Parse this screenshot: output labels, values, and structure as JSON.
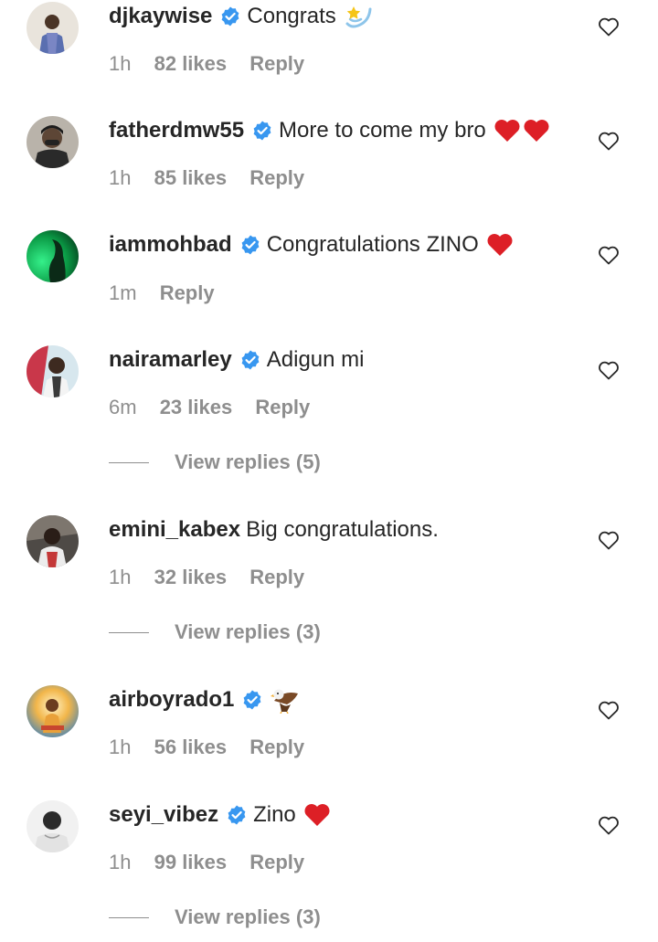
{
  "icons": {
    "verified": "verified-badge-icon",
    "like": "heart-outline-icon",
    "heart_emoji": "red-heart-emoji",
    "sparkles_emoji": "dizzy-star-emoji",
    "eagle_emoji": "eagle-emoji"
  },
  "colors": {
    "verified_blue": "#3897f0",
    "secondary_text": "#8e8e8e",
    "heart_red": "#e0245e"
  },
  "comments": [
    {
      "username": "djkaywise",
      "text": "Congrats",
      "time": "1h",
      "likes": "82 likes",
      "reply": "Reply"
    },
    {
      "username": "fatherdmw55",
      "text": "More to come my bro",
      "time": "1h",
      "likes": "85 likes",
      "reply": "Reply"
    },
    {
      "username": "iammohbad",
      "text": "Congratulations ZINO",
      "time": "1m",
      "reply": "Reply"
    },
    {
      "username": "nairamarley",
      "text": "Adigun mi",
      "time": "6m",
      "likes": "23 likes",
      "reply": "Reply",
      "view_replies": "View replies (5)"
    },
    {
      "username": "emini_kabex",
      "text": "Big congratulations.",
      "time": "1h",
      "likes": "32 likes",
      "reply": "Reply",
      "view_replies": "View replies (3)"
    },
    {
      "username": "airboyrado1",
      "text": "",
      "time": "1h",
      "likes": "56 likes",
      "reply": "Reply"
    },
    {
      "username": "seyi_vibez",
      "text": "Zino",
      "time": "1h",
      "likes": "99 likes",
      "reply": "Reply",
      "view_replies": "View replies (3)"
    }
  ]
}
